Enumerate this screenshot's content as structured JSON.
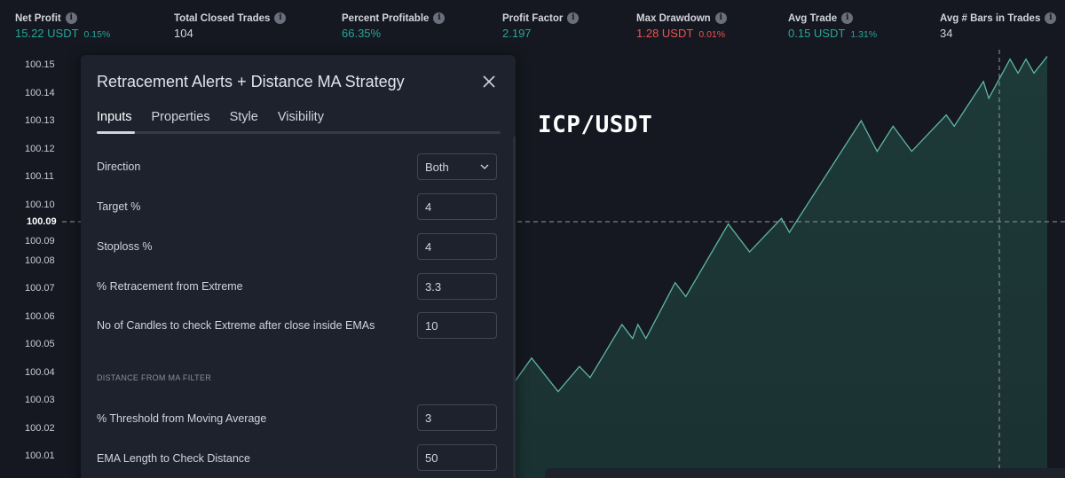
{
  "stats": [
    {
      "label": "Net Profit",
      "value": "15.22 USDT",
      "sub": "0.15%",
      "tone": "pos"
    },
    {
      "label": "Total Closed Trades",
      "value": "104",
      "sub": "",
      "tone": "neutral"
    },
    {
      "label": "Percent Profitable",
      "value": "66.35%",
      "sub": "",
      "tone": "pos"
    },
    {
      "label": "Profit Factor",
      "value": "2.197",
      "sub": "",
      "tone": "pos"
    },
    {
      "label": "Max Drawdown",
      "value": "1.28 USDT",
      "sub": "0.01%",
      "tone": "neg"
    },
    {
      "label": "Avg Trade",
      "value": "0.15 USDT",
      "sub": "1.31%",
      "tone": "pos"
    },
    {
      "label": "Avg # Bars in Trades",
      "value": "34",
      "sub": "",
      "tone": "neutral"
    }
  ],
  "info_icon_glyph": "i",
  "chart_data": {
    "type": "area",
    "symbol": "ICP/USDT",
    "y_ticks": [
      "100.15",
      "100.14",
      "100.13",
      "100.12",
      "100.11",
      "100.10",
      "100.09",
      "100.08",
      "100.07",
      "100.06",
      "100.05",
      "100.04",
      "100.03",
      "100.02",
      "100.01"
    ],
    "crosshair_y": "100.09",
    "ylim": [
      100.0,
      100.155
    ],
    "visible_points": [
      [
        0,
        100.037
      ],
      [
        0.03,
        100.045
      ],
      [
        0.08,
        100.033
      ],
      [
        0.12,
        100.042
      ],
      [
        0.14,
        100.038
      ],
      [
        0.2,
        100.057
      ],
      [
        0.22,
        100.052
      ],
      [
        0.23,
        100.057
      ],
      [
        0.245,
        100.052
      ],
      [
        0.3,
        100.072
      ],
      [
        0.32,
        100.067
      ],
      [
        0.4,
        100.093
      ],
      [
        0.44,
        100.083
      ],
      [
        0.5,
        100.095
      ],
      [
        0.515,
        100.09
      ],
      [
        0.65,
        100.13
      ],
      [
        0.68,
        100.119
      ],
      [
        0.71,
        100.128
      ],
      [
        0.745,
        100.119
      ],
      [
        0.81,
        100.132
      ],
      [
        0.825,
        100.128
      ],
      [
        0.88,
        100.144
      ],
      [
        0.89,
        100.138
      ],
      [
        0.93,
        100.152
      ],
      [
        0.945,
        100.147
      ],
      [
        0.96,
        100.152
      ],
      [
        0.975,
        100.147
      ],
      [
        1.0,
        100.153
      ]
    ],
    "line_color": "#5fb5a7",
    "fill_color": "#1d3a38",
    "grid": false
  },
  "dialog": {
    "title": "Retracement Alerts + Distance MA Strategy",
    "tabs": [
      "Inputs",
      "Properties",
      "Style",
      "Visibility"
    ],
    "active_tab": "Inputs",
    "direction": {
      "label": "Direction",
      "value": "Both"
    },
    "target": {
      "label": "Target %",
      "value": "4"
    },
    "stoploss": {
      "label": "Stoploss %",
      "value": "4"
    },
    "retracement": {
      "label": "% Retracement from Extreme",
      "value": "3.3"
    },
    "candles": {
      "label": "No of Candles to check Extreme after close inside EMAs",
      "value": "10"
    },
    "section": "DISTANCE FROM MA FILTER",
    "threshold": {
      "label": "% Threshold from Moving Average",
      "value": "3"
    },
    "ema_length": {
      "label": "EMA Length to Check Distance",
      "value": "50"
    }
  }
}
